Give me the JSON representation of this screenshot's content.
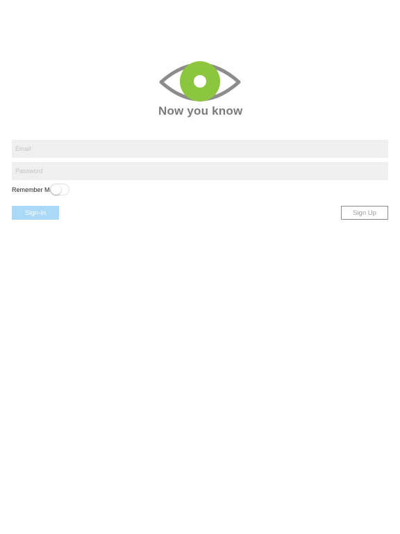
{
  "logo": {
    "text": "Now you know",
    "colors": {
      "outline": "#8c8c8c",
      "iris": "#8cc63e",
      "pupil": "#ffffff"
    }
  },
  "form": {
    "email_placeholder": "Email",
    "password_placeholder": "Password",
    "remember_label": "Remember Me",
    "remember_on": false
  },
  "buttons": {
    "signin_label": "Sign-In",
    "signup_label": "Sign Up",
    "signin_color": "#aad9f7"
  }
}
